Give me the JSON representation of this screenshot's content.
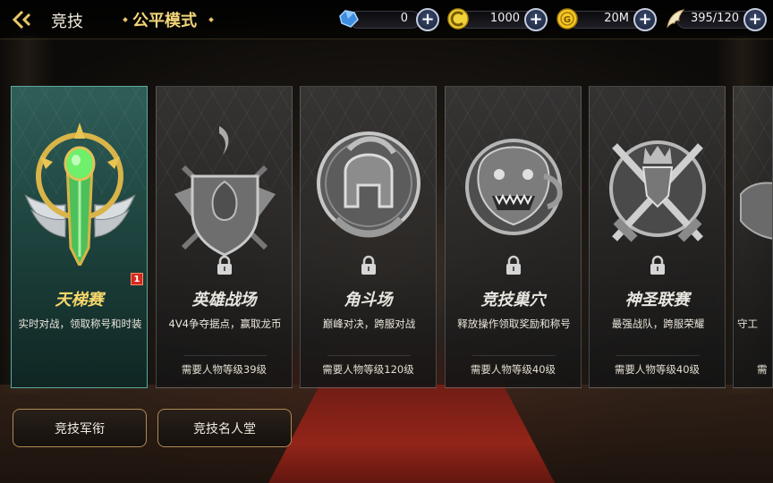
{
  "header": {
    "title": "竞技",
    "mode": "公平模式"
  },
  "resources": [
    {
      "name": "diamond",
      "icon": "blue-crystal-icon",
      "value": "0"
    },
    {
      "name": "coin-c",
      "icon": "c-coin-icon",
      "value": "1000"
    },
    {
      "name": "gold",
      "icon": "gold-coin-icon",
      "value": "20M"
    },
    {
      "name": "stamina",
      "icon": "wing-icon",
      "value": "395/120"
    }
  ],
  "cards": [
    {
      "name": "天梯赛",
      "desc": "实时对战，领取称号和时装",
      "requirement": "",
      "locked": false,
      "badge": "1"
    },
    {
      "name": "英雄战场",
      "desc": "4V4争夺据点，赢取龙币",
      "requirement": "需要人物等级39级",
      "locked": true
    },
    {
      "name": "角斗场",
      "desc": "巅峰对决，跨服对战",
      "requirement": "需要人物等级120级",
      "locked": true
    },
    {
      "name": "竞技巢穴",
      "desc": "释放操作领取奖励和称号",
      "requirement": "需要人物等级40级",
      "locked": true
    },
    {
      "name": "神圣联赛",
      "desc": "最强战队，跨服荣耀",
      "requirement": "需要人物等级40级",
      "locked": true
    },
    {
      "name": "",
      "desc": "守工",
      "requirement": "需",
      "locked": false
    }
  ],
  "buttons": {
    "armory": "竞技军衔",
    "hall_of_fame": "竞技名人堂"
  },
  "colors": {
    "accent_gold": "#f3d57a",
    "active_card": "#2f5e58",
    "badge_red": "#d42a1e"
  }
}
